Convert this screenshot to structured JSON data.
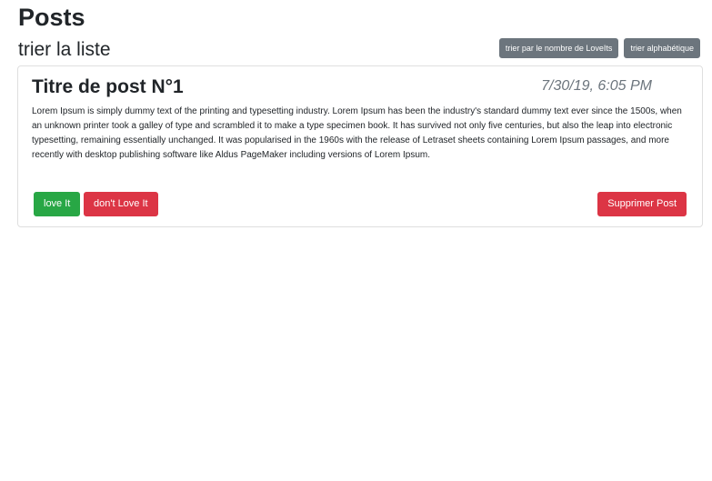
{
  "page": {
    "title": "Posts"
  },
  "sort": {
    "title": "trier la liste",
    "by_loves_label": "trier par le nombre de LoveIts",
    "alphabetical_label": "trier alphabétique"
  },
  "posts": [
    {
      "title": "Titre de post N°1",
      "date": "7/30/19, 6:05 PM",
      "content": "Lorem Ipsum is simply dummy text of the printing and typesetting industry. Lorem Ipsum has been the industry's standard dummy text ever since the 1500s, when an unknown printer took a galley of type and scrambled it to make a type specimen book. It has survived not only five centuries, but also the leap into electronic typesetting, remaining essentially unchanged. It was popularised in the 1960s with the release of Letraset sheets containing Lorem Ipsum passages, and more recently with desktop publishing software like Aldus PageMaker including versions of Lorem Ipsum.",
      "love_label": "love It",
      "dont_love_label": "don't Love It",
      "delete_label": "Supprimer Post"
    }
  ],
  "colors": {
    "secondary": "#6c757d",
    "success": "#28a745",
    "danger": "#dc3545",
    "date_text": "#6c757d"
  }
}
